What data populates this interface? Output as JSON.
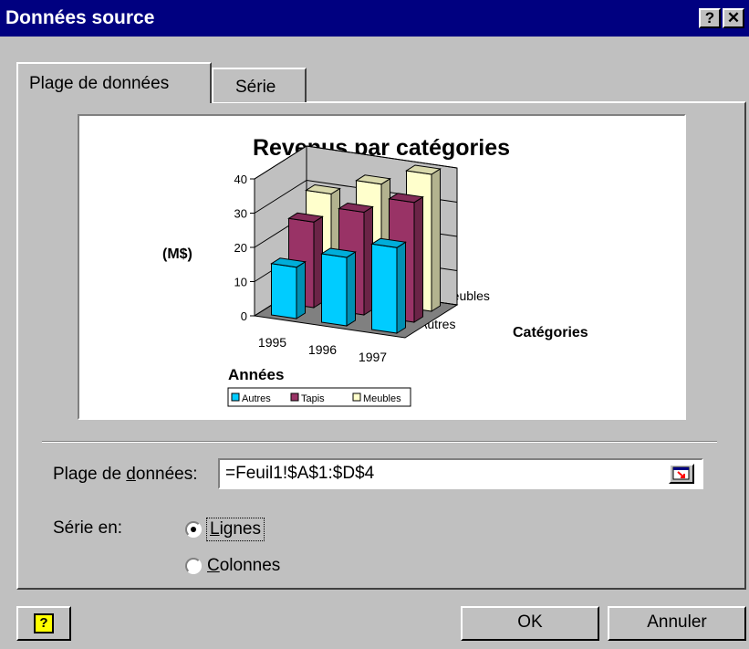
{
  "window": {
    "title": "Données source",
    "help_btn": "?",
    "close_btn": "✕"
  },
  "tabs": [
    {
      "label": "Plage de données",
      "active": true
    },
    {
      "label": "Série",
      "active": false
    }
  ],
  "chart_data": {
    "type": "bar",
    "title": "Revenus par catégories",
    "ylabel": "(M$)",
    "xlabel": "Années",
    "zlabel": "Catégories",
    "categories": [
      "1995",
      "1996",
      "1997"
    ],
    "depth_tick_labels": [
      "Autres",
      "Meubles"
    ],
    "yticks": [
      "0",
      "10",
      "20",
      "30",
      "40"
    ],
    "ylim": [
      0,
      40
    ],
    "legend_position": "bottom",
    "grid": true,
    "series": [
      {
        "name": "Autres",
        "values": [
          15,
          20,
          25
        ],
        "color": "#00ccff"
      },
      {
        "name": "Tapis",
        "values": [
          25,
          30,
          35
        ],
        "color": "#993366"
      },
      {
        "name": "Meubles",
        "values": [
          30,
          35,
          40
        ],
        "color": "#ffffcc"
      }
    ]
  },
  "range": {
    "label_pre": "Plage de ",
    "label_u": "d",
    "label_post": "onnées:",
    "value": "=Feuil1!$A$1:$D$4"
  },
  "series_in": {
    "label": "Série en:",
    "options": [
      {
        "pre": "",
        "u": "L",
        "post": "ignes",
        "selected": true
      },
      {
        "pre": "",
        "u": "C",
        "post": "olonnes",
        "selected": false
      }
    ]
  },
  "buttons": {
    "help_icon": "?",
    "ok": "OK",
    "cancel": "Annuler"
  }
}
